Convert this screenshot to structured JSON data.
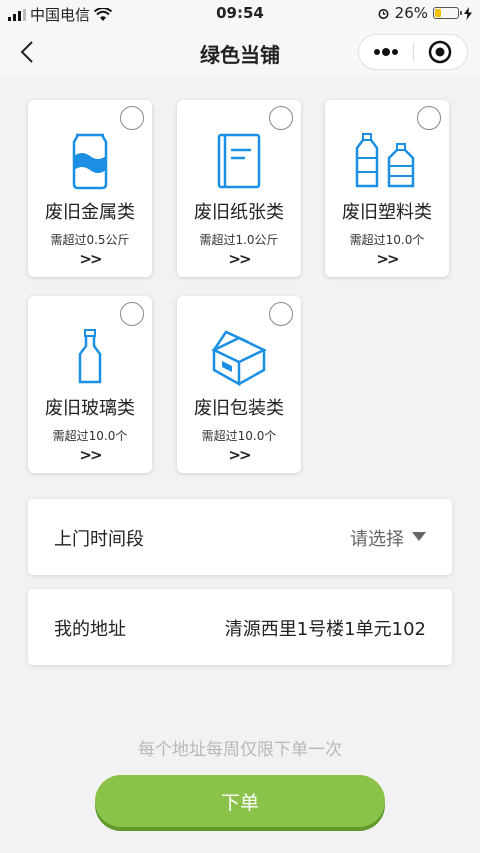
{
  "status_bar": {
    "carrier": "中国电信",
    "time": "09:54",
    "battery_percent": "26%",
    "battery_level": 0.26
  },
  "nav": {
    "title": "绿色当铺"
  },
  "categories": [
    {
      "name": "废旧金属类",
      "requirement": "需超过0.5公斤",
      "more": ">>",
      "icon": "can-icon"
    },
    {
      "name": "废旧纸张类",
      "requirement": "需超过1.0公斤",
      "more": ">>",
      "icon": "paper-icon"
    },
    {
      "name": "废旧塑料类",
      "requirement": "需超过10.0个",
      "more": ">>",
      "icon": "plastic-bottles-icon"
    },
    {
      "name": "废旧玻璃类",
      "requirement": "需超过10.0个",
      "more": ">>",
      "icon": "glass-bottle-icon"
    },
    {
      "name": "废旧包装类",
      "requirement": "需超过10.0个",
      "more": ">>",
      "icon": "box-icon"
    }
  ],
  "time_slot": {
    "label": "上门时间段",
    "placeholder": "请选择"
  },
  "address": {
    "label": "我的地址",
    "value": "清源西里1号楼1单元102"
  },
  "notice": "每个地址每周仅限下单一次",
  "submit_label": "下单",
  "colors": {
    "accent": "#1a8fe3",
    "button": "#8bc34a"
  }
}
